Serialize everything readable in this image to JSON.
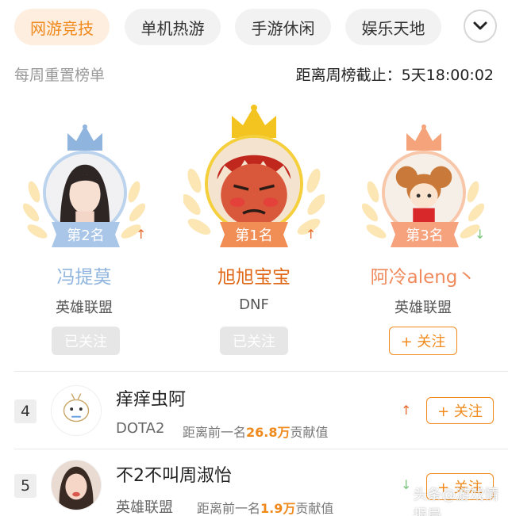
{
  "tabs": [
    {
      "label": "网游竞技",
      "active": true
    },
    {
      "label": "单机热游",
      "active": false
    },
    {
      "label": "手游休闲",
      "active": false
    },
    {
      "label": "娱乐天地",
      "active": false
    }
  ],
  "more_icon": "chevron-down-icon",
  "subheader": {
    "left": "每周重置榜单",
    "right": "距离周榜截止：5天18:00:02"
  },
  "podium": [
    {
      "rank_label": "第2名",
      "name": "冯提莫",
      "game": "英雄联盟",
      "follow_label": "已关注",
      "followed": true,
      "trend": "up",
      "color": "#8fb4de"
    },
    {
      "rank_label": "第1名",
      "name": "旭旭宝宝",
      "game": "DNF",
      "follow_label": "已关注",
      "followed": true,
      "trend": "up",
      "color": "#f3c420"
    },
    {
      "rank_label": "第3名",
      "name": "阿冷aleng丶",
      "game": "英雄联盟",
      "follow_label": "+ 关注",
      "followed": false,
      "trend": "down",
      "color": "#f4a37a"
    }
  ],
  "list": [
    {
      "rank": "4",
      "name": "痒痒虫阿",
      "game": "DOTA2",
      "gap_prefix": "距离前一名",
      "gap_value": "26.8万",
      "gap_suffix": "贡献值",
      "trend": "up",
      "follow_label": "+ 关注"
    },
    {
      "rank": "5",
      "name": "不2不叫周淑怡",
      "game": "英雄联盟",
      "gap_prefix": "距离前一名",
      "gap_value": "1.9万",
      "gap_suffix": "贡献值",
      "trend": "down",
      "follow_label": "+ 关注"
    }
  ],
  "trend_symbols": {
    "up": "↑",
    "down": "↓"
  },
  "watermark": "头条@游戏情报局",
  "colors": {
    "accent": "#f08a1c",
    "trend_up": "#e8692c",
    "trend_down": "#7bc47b",
    "first_name": "#e06a1a",
    "second_name": "#8fb4de",
    "third_name": "#f08a5c"
  }
}
